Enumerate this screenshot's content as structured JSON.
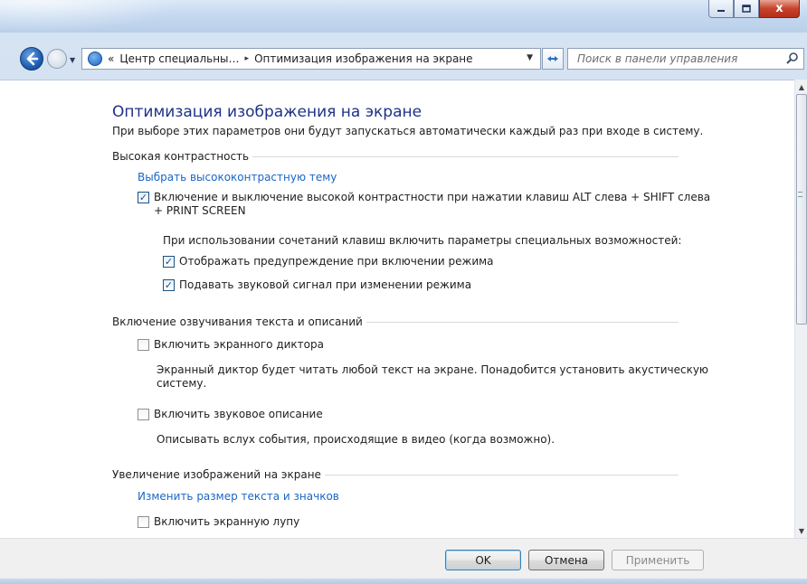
{
  "window": {
    "minimize_icon": "minimize-icon",
    "maximize_icon": "maximize-icon",
    "close_label": "x"
  },
  "nav": {
    "breadcrumb_prefix": "«",
    "breadcrumb_parent": "Центр специальны…",
    "breadcrumb_separator": "▸",
    "breadcrumb_current": "Оптимизация изображения на экране",
    "search_placeholder": "Поиск в панели управления"
  },
  "page": {
    "title": "Оптимизация изображения на экране",
    "subtitle": "При выборе этих параметров они будут запускаться автоматически каждый раз при входе в систему."
  },
  "sections": {
    "high_contrast": {
      "heading": "Высокая контрастность",
      "link": "Выбрать высококонтрастную тему",
      "toggle_label_line1": "Включение и выключение высокой контрастности при нажатии клавиш ALT слева + SHIFT слева",
      "toggle_label_line2": "+ PRINT SCREEN",
      "toggle_checked": true,
      "shortcut_note": "При использовании сочетаний клавиш включить параметры специальных возможностей:",
      "warning_label": "Отображать предупреждение при включении режима",
      "warning_checked": true,
      "sound_label": "Подавать звуковой сигнал при изменении режима",
      "sound_checked": true
    },
    "narration": {
      "heading": "Включение озвучивания текста и описаний",
      "narrator_label": "Включить экранного диктора",
      "narrator_checked": false,
      "narrator_desc_line1": "Экранный диктор будет читать любой текст на экране. Понадобится установить акустическую",
      "narrator_desc_line2": "систему.",
      "audio_desc_label": "Включить звуковое описание",
      "audio_desc_checked": false,
      "audio_desc_text": "Описывать вслух события, происходящие в видео (когда возможно)."
    },
    "magnify": {
      "heading": "Увеличение изображений на экране",
      "link": "Изменить размер текста и значков",
      "magnifier_label": "Включить экранную лупу",
      "magnifier_checked": false
    }
  },
  "footer": {
    "ok": "OK",
    "cancel": "Отмена",
    "apply": "Применить"
  }
}
